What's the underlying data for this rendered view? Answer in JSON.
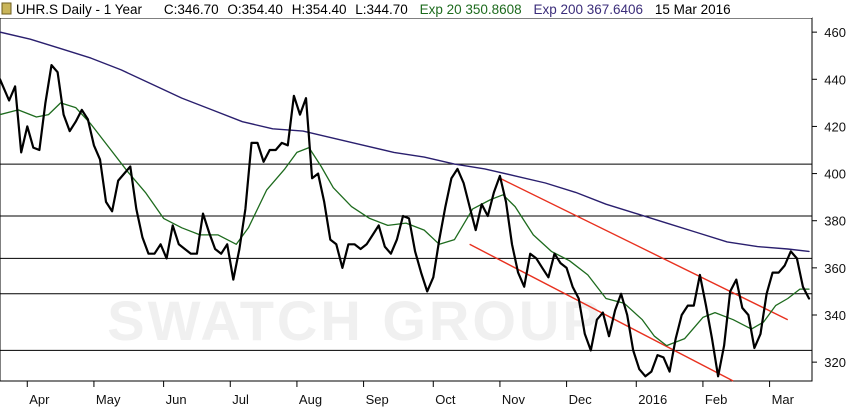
{
  "header": {
    "symbol": "UHR.S Daily -  1 Year",
    "close": "C:346.70",
    "open": "O:354.40",
    "high": "H:354.40",
    "low": "L:344.70",
    "ema20_label": "Exp 20 350.8608",
    "ema200_label": "Exp 200 367.6406",
    "date": "15 Mar 2016"
  },
  "watermark": "SWATCH GROUP",
  "colors": {
    "price": "#000000",
    "ema20": "#1e6b1e",
    "ema200": "#2a1f6e",
    "trend": "#e8311f",
    "ema20_text": "#1e6b1e",
    "ema200_text": "#3b2d7a",
    "grid": "#000000"
  },
  "chart_data": {
    "type": "line",
    "x_tick_labels": [
      "Apr",
      "May",
      "Jun",
      "Jul",
      "Aug",
      "Sep",
      "Oct",
      "Nov",
      "Dec",
      "2016",
      "Feb",
      "Mar"
    ],
    "x_tick_index": [
      9,
      31,
      54,
      76,
      98,
      120,
      143,
      165,
      187,
      210,
      232,
      254
    ],
    "y_ticks": [
      320,
      340,
      360,
      380,
      400,
      420,
      440,
      460
    ],
    "ylim": [
      312,
      466
    ],
    "xlim": [
      0,
      268
    ],
    "horizontal_levels": [
      325,
      349,
      364,
      382,
      404
    ],
    "trendlines": [
      {
        "x1": 165,
        "y1": 398,
        "x2": 260,
        "y2": 338
      },
      {
        "x1": 155,
        "y1": 370,
        "x2": 242,
        "y2": 312
      }
    ],
    "series": [
      {
        "name": "UHR.S",
        "key": "price",
        "keypoints": [
          [
            0,
            440
          ],
          [
            3,
            431
          ],
          [
            5,
            437
          ],
          [
            7,
            409
          ],
          [
            9,
            420
          ],
          [
            11,
            411
          ],
          [
            13,
            410
          ],
          [
            15,
            430
          ],
          [
            17,
            446
          ],
          [
            19,
            443
          ],
          [
            21,
            425
          ],
          [
            23,
            418
          ],
          [
            25,
            422
          ],
          [
            27,
            427
          ],
          [
            29,
            423
          ],
          [
            31,
            412
          ],
          [
            33,
            406
          ],
          [
            35,
            388
          ],
          [
            37,
            384
          ],
          [
            39,
            397
          ],
          [
            41,
            400
          ],
          [
            43,
            403
          ],
          [
            45,
            385
          ],
          [
            47,
            373
          ],
          [
            49,
            366
          ],
          [
            51,
            366
          ],
          [
            53,
            370
          ],
          [
            55,
            364
          ],
          [
            57,
            378
          ],
          [
            59,
            370
          ],
          [
            61,
            368
          ],
          [
            63,
            366
          ],
          [
            65,
            366
          ],
          [
            67,
            383
          ],
          [
            69,
            375
          ],
          [
            71,
            368
          ],
          [
            73,
            366
          ],
          [
            75,
            370
          ],
          [
            77,
            355
          ],
          [
            79,
            368
          ],
          [
            81,
            385
          ],
          [
            83,
            413
          ],
          [
            85,
            413
          ],
          [
            87,
            405
          ],
          [
            89,
            410
          ],
          [
            91,
            410
          ],
          [
            93,
            413
          ],
          [
            95,
            412
          ],
          [
            97,
            433
          ],
          [
            99,
            425
          ],
          [
            101,
            432
          ],
          [
            103,
            398
          ],
          [
            105,
            400
          ],
          [
            107,
            388
          ],
          [
            109,
            372
          ],
          [
            111,
            370
          ],
          [
            113,
            360
          ],
          [
            115,
            370
          ],
          [
            117,
            370
          ],
          [
            119,
            368
          ],
          [
            121,
            370
          ],
          [
            123,
            374
          ],
          [
            125,
            378
          ],
          [
            127,
            369
          ],
          [
            129,
            366
          ],
          [
            131,
            372
          ],
          [
            133,
            382
          ],
          [
            135,
            381
          ],
          [
            137,
            367
          ],
          [
            139,
            358
          ],
          [
            141,
            350
          ],
          [
            143,
            356
          ],
          [
            145,
            372
          ],
          [
            147,
            386
          ],
          [
            149,
            398
          ],
          [
            151,
            402
          ],
          [
            153,
            396
          ],
          [
            155,
            386
          ],
          [
            157,
            376
          ],
          [
            159,
            387
          ],
          [
            161,
            382
          ],
          [
            163,
            392
          ],
          [
            165,
            399
          ],
          [
            167,
            388
          ],
          [
            169,
            370
          ],
          [
            171,
            358
          ],
          [
            173,
            352
          ],
          [
            175,
            366
          ],
          [
            177,
            364
          ],
          [
            179,
            360
          ],
          [
            181,
            356
          ],
          [
            183,
            366
          ],
          [
            185,
            362
          ],
          [
            187,
            360
          ],
          [
            189,
            352
          ],
          [
            191,
            347
          ],
          [
            193,
            332
          ],
          [
            195,
            325
          ],
          [
            197,
            338
          ],
          [
            199,
            341
          ],
          [
            201,
            331
          ],
          [
            203,
            342
          ],
          [
            205,
            349
          ],
          [
            207,
            340
          ],
          [
            209,
            325
          ],
          [
            211,
            317
          ],
          [
            213,
            314
          ],
          [
            215,
            316
          ],
          [
            217,
            323
          ],
          [
            219,
            322
          ],
          [
            221,
            316
          ],
          [
            223,
            330
          ],
          [
            225,
            340
          ],
          [
            227,
            344
          ],
          [
            229,
            344
          ],
          [
            231,
            357
          ],
          [
            233,
            344
          ],
          [
            235,
            330
          ],
          [
            237,
            314
          ],
          [
            239,
            327
          ],
          [
            241,
            350
          ],
          [
            243,
            355
          ],
          [
            245,
            343
          ],
          [
            247,
            340
          ],
          [
            249,
            326
          ],
          [
            251,
            332
          ],
          [
            253,
            349
          ],
          [
            255,
            358
          ],
          [
            257,
            358
          ],
          [
            259,
            361
          ],
          [
            261,
            367
          ],
          [
            263,
            364
          ],
          [
            265,
            352
          ],
          [
            267,
            347
          ]
        ]
      },
      {
        "name": "Exp 20",
        "key": "ema20",
        "keypoints": [
          [
            0,
            425
          ],
          [
            6,
            427
          ],
          [
            12,
            424
          ],
          [
            16,
            425
          ],
          [
            20,
            430
          ],
          [
            25,
            428
          ],
          [
            30,
            421
          ],
          [
            36,
            411
          ],
          [
            42,
            401
          ],
          [
            48,
            392
          ],
          [
            54,
            381
          ],
          [
            60,
            377
          ],
          [
            66,
            374
          ],
          [
            72,
            374
          ],
          [
            78,
            370
          ],
          [
            82,
            377
          ],
          [
            88,
            393
          ],
          [
            94,
            402
          ],
          [
            98,
            409
          ],
          [
            102,
            411
          ],
          [
            106,
            403
          ],
          [
            110,
            394
          ],
          [
            116,
            386
          ],
          [
            122,
            381
          ],
          [
            128,
            378
          ],
          [
            134,
            379
          ],
          [
            140,
            376
          ],
          [
            145,
            370
          ],
          [
            150,
            372
          ],
          [
            156,
            385
          ],
          [
            162,
            389
          ],
          [
            166,
            391
          ],
          [
            170,
            386
          ],
          [
            176,
            374
          ],
          [
            182,
            367
          ],
          [
            188,
            363
          ],
          [
            194,
            357
          ],
          [
            200,
            347
          ],
          [
            206,
            345
          ],
          [
            212,
            338
          ],
          [
            216,
            331
          ],
          [
            220,
            327
          ],
          [
            226,
            330
          ],
          [
            232,
            339
          ],
          [
            236,
            341
          ],
          [
            242,
            338
          ],
          [
            248,
            334
          ],
          [
            252,
            337
          ],
          [
            256,
            344
          ],
          [
            260,
            347
          ],
          [
            264,
            351
          ],
          [
            267,
            351
          ]
        ]
      },
      {
        "name": "Exp 200",
        "key": "ema200",
        "keypoints": [
          [
            0,
            460
          ],
          [
            10,
            457
          ],
          [
            20,
            453
          ],
          [
            30,
            449
          ],
          [
            40,
            444
          ],
          [
            50,
            438
          ],
          [
            60,
            432
          ],
          [
            70,
            427
          ],
          [
            80,
            422
          ],
          [
            90,
            419
          ],
          [
            100,
            418
          ],
          [
            110,
            415
          ],
          [
            120,
            412
          ],
          [
            130,
            409
          ],
          [
            140,
            407
          ],
          [
            150,
            404
          ],
          [
            160,
            402
          ],
          [
            170,
            399
          ],
          [
            180,
            396
          ],
          [
            190,
            392
          ],
          [
            200,
            387
          ],
          [
            210,
            383
          ],
          [
            220,
            379
          ],
          [
            230,
            375
          ],
          [
            240,
            371
          ],
          [
            250,
            369
          ],
          [
            260,
            368
          ],
          [
            267,
            367
          ]
        ]
      }
    ]
  }
}
